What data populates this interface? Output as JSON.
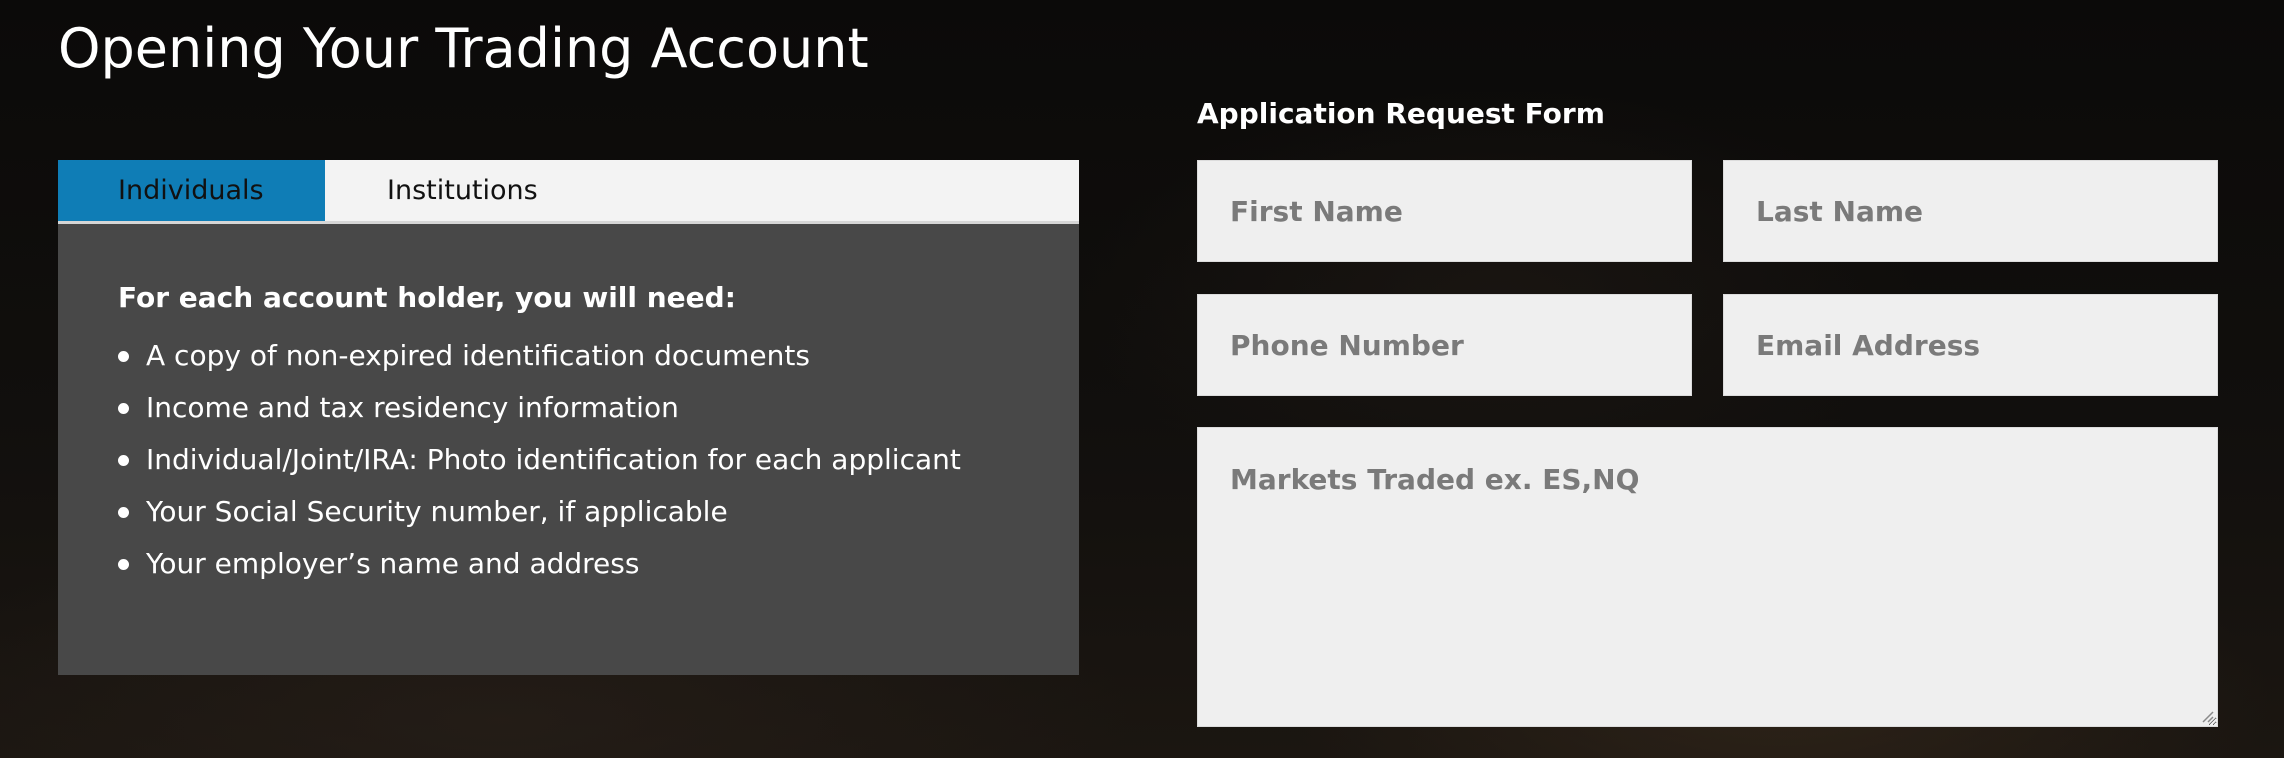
{
  "page": {
    "title": "Opening Your Trading Account"
  },
  "tabs": [
    {
      "label": "Individuals",
      "active": true
    },
    {
      "label": "Institutions",
      "active": false
    }
  ],
  "requirements": {
    "heading": "For each account holder, you will need:",
    "items": [
      "A copy of non-expired identification documents",
      "Income and tax residency information",
      "Individual/Joint/IRA: Photo identification for each applicant",
      "Your Social Security number, if applicable",
      "Your employer’s name and address"
    ]
  },
  "form": {
    "title": "Application Request Form",
    "first_name": {
      "placeholder": "First Name",
      "value": ""
    },
    "last_name": {
      "placeholder": "Last Name",
      "value": ""
    },
    "phone": {
      "placeholder": "Phone Number",
      "value": ""
    },
    "email": {
      "placeholder": "Email Address",
      "value": ""
    },
    "markets": {
      "placeholder": "Markets Traded ex. ES,NQ",
      "value": ""
    }
  },
  "colors": {
    "active_tab": "#0f7db6",
    "tab_bar": "#f3f3f3",
    "panel": "#484848",
    "input_bg": "#efefef",
    "page_bg": "#0c0b0a"
  },
  "icons": {
    "bullet": "bullet-icon",
    "resize": "resize-handle-icon"
  }
}
